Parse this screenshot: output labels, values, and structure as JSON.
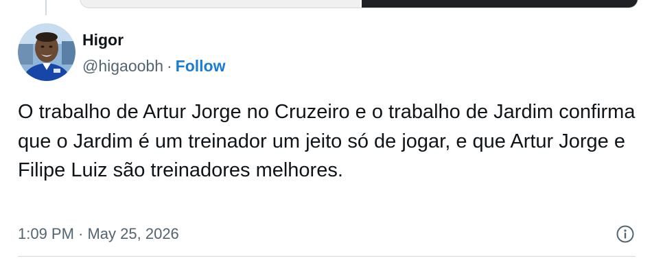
{
  "tweet": {
    "author": {
      "display_name": "Higor",
      "handle": "@higaoobh",
      "separator": "·",
      "follow_label": "Follow",
      "avatar_icon": "avatar-photo"
    },
    "text": "O trabalho de Artur Jorge no Cruzeiro e o trabalho de Jardim confirma que o Jardim é um treinador um jeito só de jogar, e que Artur Jorge e Filipe Luiz são treinadores melhores.",
    "timestamp": "1:09 PM · May 25, 2026",
    "info_icon": "info-icon"
  },
  "colors": {
    "text_primary": "#0f1419",
    "text_secondary": "#536471",
    "link": "#1a7cd6",
    "border": "#cfd9de"
  }
}
